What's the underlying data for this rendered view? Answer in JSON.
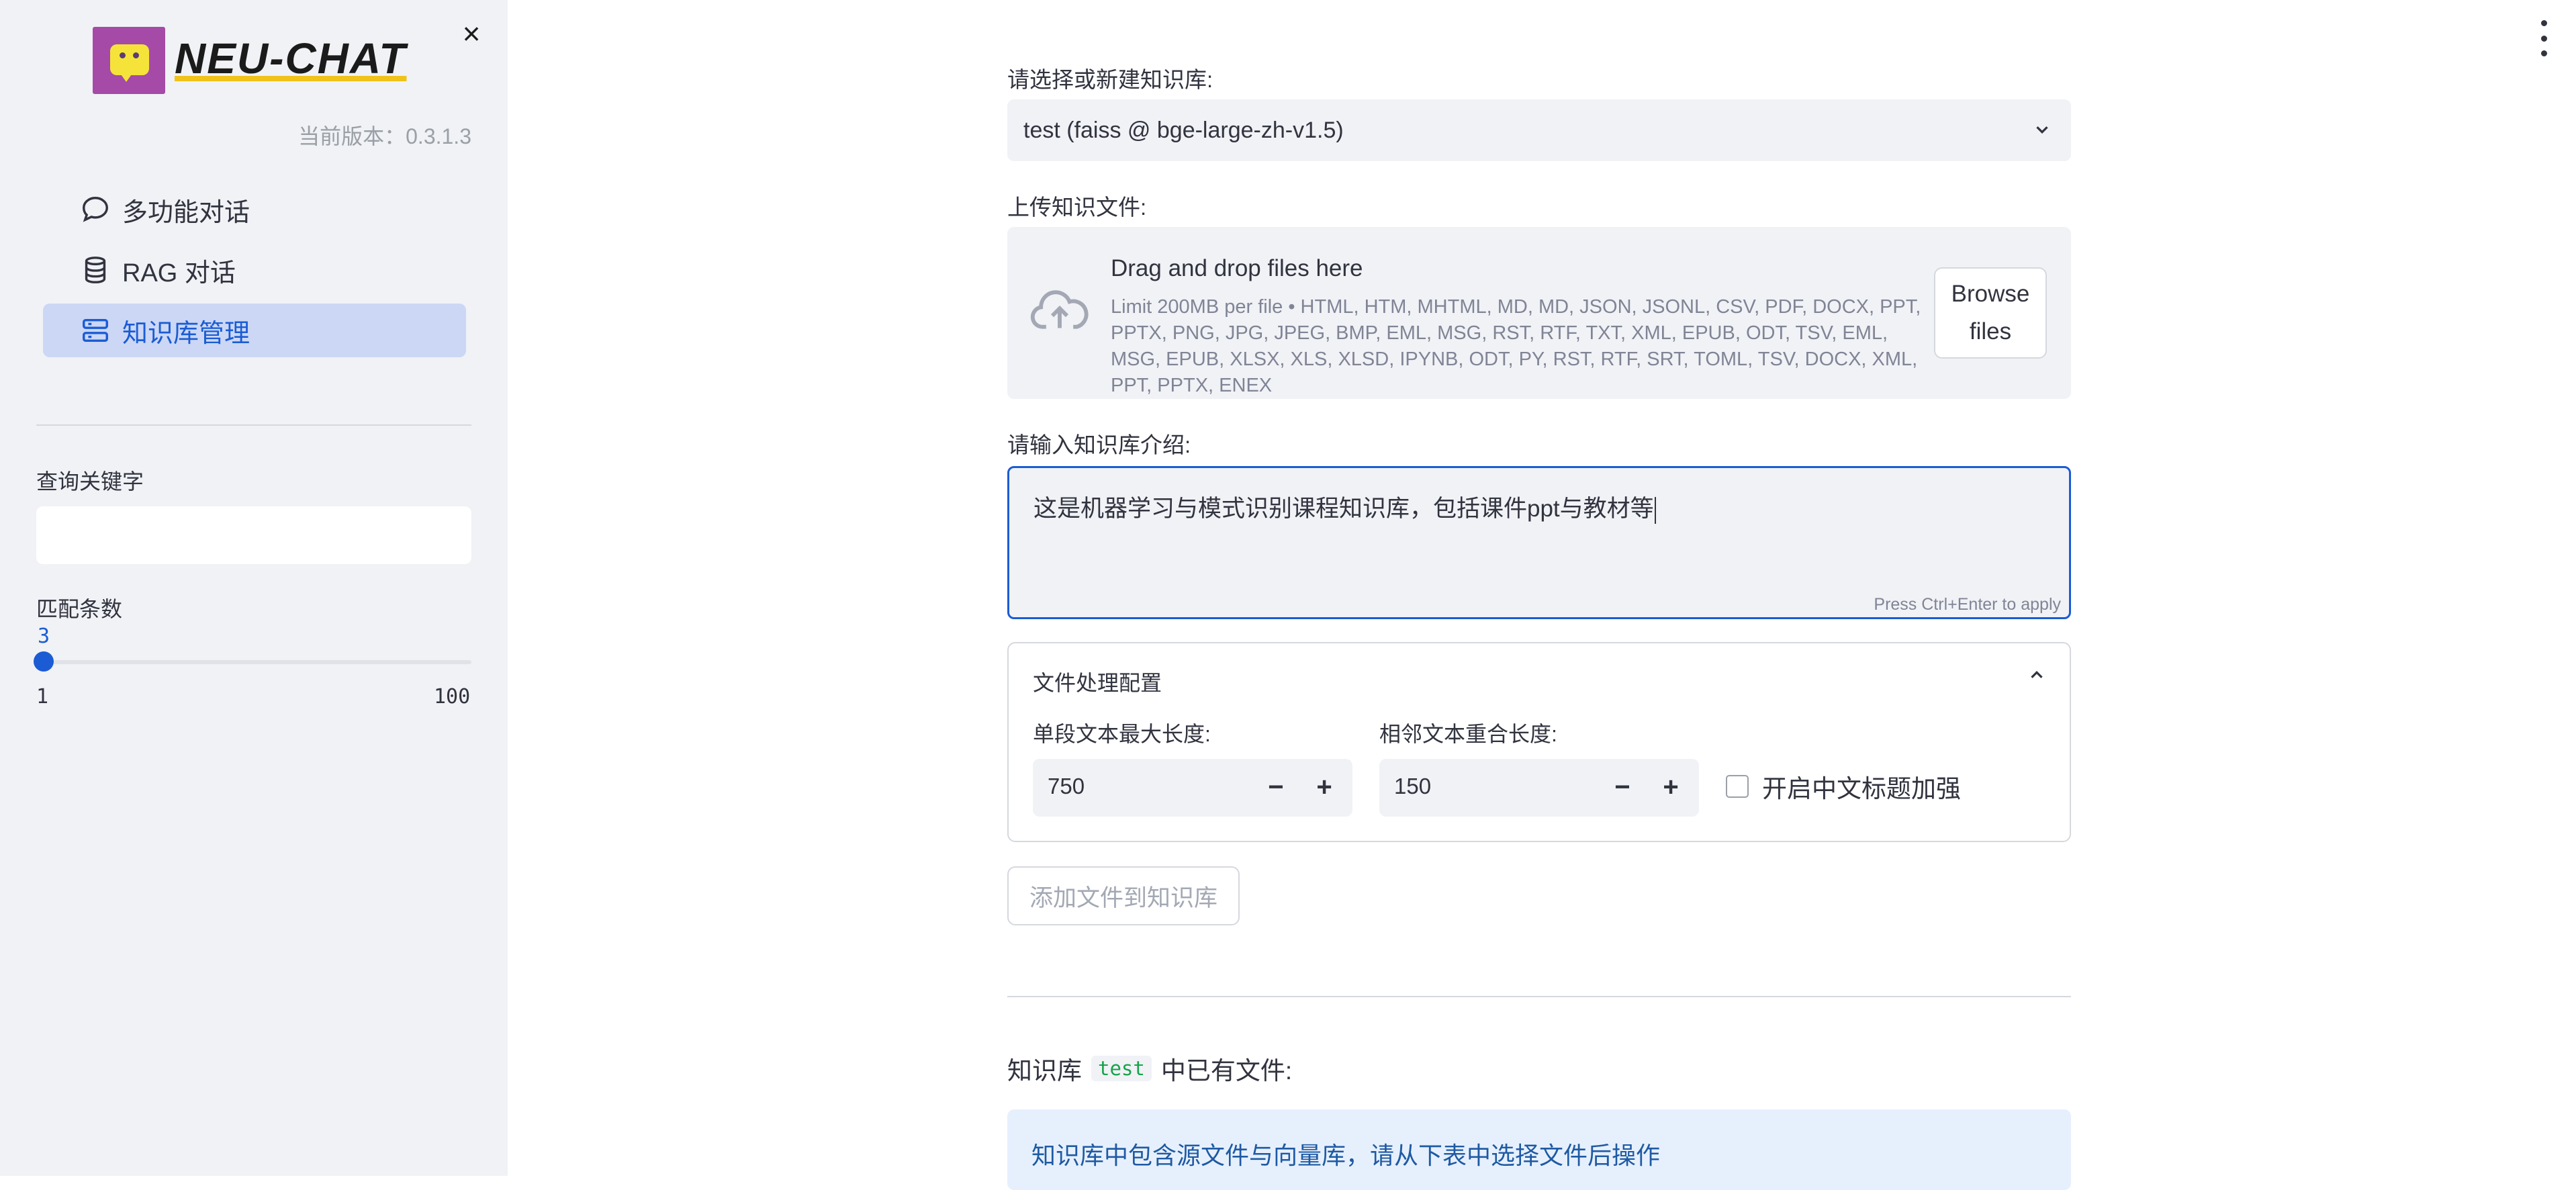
{
  "sidebar": {
    "logo_text": "NEU-CHAT",
    "version_text": "当前版本：0.3.1.3",
    "nav": [
      {
        "label": "多功能对话",
        "icon": "chat-bubble-icon",
        "active": false
      },
      {
        "label": "RAG 对话",
        "icon": "database-icon",
        "active": false
      },
      {
        "label": "知识库管理",
        "icon": "server-stack-icon",
        "active": true
      }
    ],
    "query_label": "查询关键字",
    "query_value": "",
    "match_label": "匹配条数",
    "slider": {
      "value": "3",
      "min": "1",
      "max": "100"
    }
  },
  "main": {
    "kb_select_label": "请选择或新建知识库:",
    "kb_select_value": "test (faiss @ bge-large-zh-v1.5)",
    "upload_label": "上传知识文件:",
    "uploader": {
      "title": "Drag and drop files here",
      "limit": "Limit 200MB per file • HTML, HTM, MHTML, MD, MD, JSON, JSONL, CSV, PDF, DOCX, PPT, PPTX, PNG, JPG, JPEG, BMP, EML, MSG, RST, RTF, TXT, XML, EPUB, ODT, TSV, EML, MSG, EPUB, XLSX, XLS, XLSD, IPYNB, ODT, PY, RST, RTF, SRT, TOML, TSV, DOCX, XML, PPT, PPTX, ENEX",
      "browse_label": "Browse files"
    },
    "intro_label": "请输入知识库介绍:",
    "intro_value": "这是机器学习与模式识别课程知识库，包括课件ppt与教材等",
    "intro_hint": "Press Ctrl+Enter to apply",
    "file_config": {
      "title": "文件处理配置",
      "chunk_size_label": "单段文本最大长度:",
      "chunk_size_value": "750",
      "overlap_label": "相邻文本重合长度:",
      "overlap_value": "150",
      "zh_title_label": "开启中文标题加强"
    },
    "add_button_label": "添加文件到知识库",
    "kb_files_prefix": "知识库",
    "kb_name": "test",
    "kb_files_suffix": "中已有文件:",
    "info_text": "知识库中包含源文件与向量库，请从下表中选择文件后操作"
  },
  "colors": {
    "accent": "#1b5cd4",
    "sidebar_bg": "#f0f2f6",
    "active_nav_bg": "#cbd7f5",
    "info_bg": "#e6f0fd",
    "code_green": "#17a34a"
  }
}
